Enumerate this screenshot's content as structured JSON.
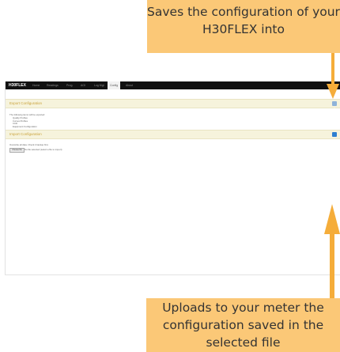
{
  "app": {
    "brand": "H30FLEX",
    "nav_tabs": [
      "Home",
      "Readings",
      "Prog.",
      "AOI",
      "Log Mgt",
      "Config",
      "About"
    ],
    "active_tab": "Config"
  },
  "export_section": {
    "title": "Export Configuration",
    "intro": "The following items will be exported:",
    "items": [
      "Quality Profiles",
      "Curves Profiles",
      "CCD",
      "Equipment Configuration"
    ],
    "button_icon": "download-icon",
    "button_color": "#8fb3d9"
  },
  "import_section": {
    "title": "Import Configuration",
    "warning": "Overwrite all data. Check it backup first.",
    "file_button": "Choose file",
    "file_status": "No file selected (select a file to import)",
    "button_icon": "upload-icon",
    "button_color": "#2f7fd0"
  },
  "callouts": {
    "top": "Saves the configuration of your H30FLEX into",
    "bottom": "Uploads to your meter the configuration saved in the selected file"
  },
  "colors": {
    "callout_bg": "#fbc877",
    "arrow": "#f5ad3a",
    "panel_header": "#f6f3dc",
    "panel_title": "#c9a23b"
  }
}
